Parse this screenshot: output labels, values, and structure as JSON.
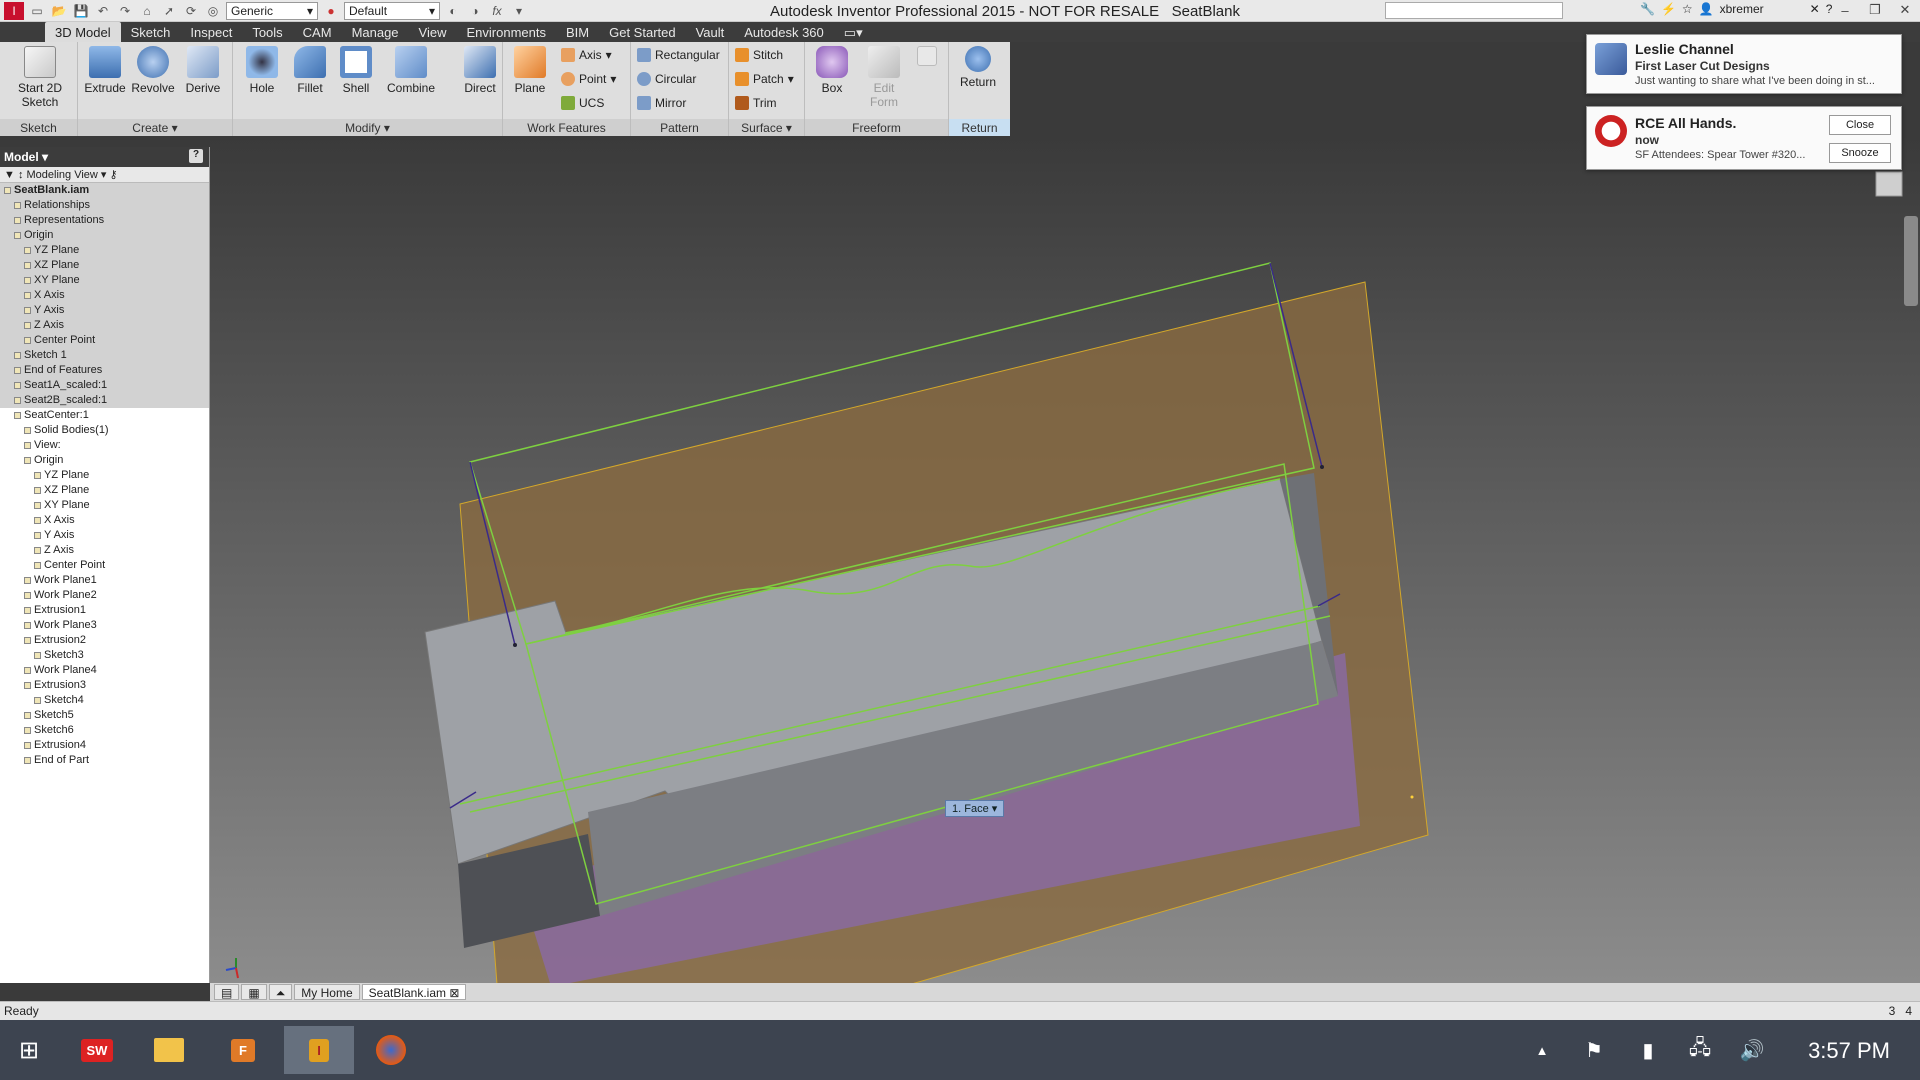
{
  "window": {
    "app_title": "Autodesk Inventor Professional 2015 - NOT FOR RESALE",
    "document": "SeatBlank",
    "material": "Generic",
    "appearance": "Default",
    "user": "xbremer"
  },
  "tabs": [
    "3D Model",
    "Sketch",
    "Inspect",
    "Tools",
    "CAM",
    "Manage",
    "View",
    "Environments",
    "BIM",
    "Get Started",
    "Vault",
    "Autodesk 360"
  ],
  "ribbon": {
    "panels": {
      "sketch": "Sketch",
      "create": "Create",
      "modify": "Modify",
      "work_features": "Work Features",
      "pattern": "Pattern",
      "surface": "Surface",
      "freeform": "Freeform",
      "return": "Return"
    },
    "buttons": {
      "start_sketch": "Start 2D Sketch",
      "extrude": "Extrude",
      "revolve": "Revolve",
      "derive": "Derive",
      "hole": "Hole",
      "fillet": "Fillet",
      "shell": "Shell",
      "combine": "Combine",
      "direct": "Direct",
      "plane": "Plane",
      "axis": "Axis",
      "point": "Point",
      "ucs": "UCS",
      "rectangular": "Rectangular",
      "circular": "Circular",
      "mirror": "Mirror",
      "stitch": "Stitch",
      "patch": "Patch",
      "trim": "Trim",
      "box": "Box",
      "edit_form": "Edit Form",
      "return": "Return"
    }
  },
  "browser": {
    "title": "Model",
    "view": "Modeling View",
    "items": [
      {
        "label": "SeatBlank.iam",
        "bold": true,
        "indent": 0,
        "grey": true
      },
      {
        "label": "Relationships",
        "indent": 1,
        "grey": true
      },
      {
        "label": "Representations",
        "indent": 1,
        "grey": true
      },
      {
        "label": "Origin",
        "indent": 1,
        "grey": true
      },
      {
        "label": "YZ Plane",
        "indent": 2,
        "grey": true
      },
      {
        "label": "XZ Plane",
        "indent": 2,
        "grey": true
      },
      {
        "label": "XY Plane",
        "indent": 2,
        "grey": true
      },
      {
        "label": "X Axis",
        "indent": 2,
        "grey": true
      },
      {
        "label": "Y Axis",
        "indent": 2,
        "grey": true
      },
      {
        "label": "Z Axis",
        "indent": 2,
        "grey": true
      },
      {
        "label": "Center Point",
        "indent": 2,
        "grey": true
      },
      {
        "label": "Sketch 1",
        "indent": 1,
        "grey": true
      },
      {
        "label": "End of Features",
        "indent": 1,
        "grey": true
      },
      {
        "label": "Seat1A_scaled:1",
        "indent": 1,
        "grey": true
      },
      {
        "label": "Seat2B_scaled:1",
        "indent": 1,
        "grey": true
      },
      {
        "label": "SeatCenter:1",
        "indent": 1
      },
      {
        "label": "Solid Bodies(1)",
        "indent": 2
      },
      {
        "label": "View:",
        "indent": 2
      },
      {
        "label": "Origin",
        "indent": 2
      },
      {
        "label": "YZ Plane",
        "indent": 3
      },
      {
        "label": "XZ Plane",
        "indent": 3
      },
      {
        "label": "XY Plane",
        "indent": 3
      },
      {
        "label": "X Axis",
        "indent": 3
      },
      {
        "label": "Y Axis",
        "indent": 3
      },
      {
        "label": "Z Axis",
        "indent": 3
      },
      {
        "label": "Center Point",
        "indent": 3
      },
      {
        "label": "Work Plane1",
        "indent": 2
      },
      {
        "label": "Work Plane2",
        "indent": 2
      },
      {
        "label": "Extrusion1",
        "indent": 2
      },
      {
        "label": "Work Plane3",
        "indent": 2
      },
      {
        "label": "Extrusion2",
        "indent": 2
      },
      {
        "label": "Sketch3",
        "indent": 3
      },
      {
        "label": "Work Plane4",
        "indent": 2
      },
      {
        "label": "Extrusion3",
        "indent": 2
      },
      {
        "label": "Sketch4",
        "indent": 3
      },
      {
        "label": "Sketch5",
        "indent": 2
      },
      {
        "label": "Sketch6",
        "indent": 2
      },
      {
        "label": "Extrusion4",
        "indent": 2
      },
      {
        "label": "End of Part",
        "indent": 2
      }
    ]
  },
  "viewport": {
    "selection_label": "1. Face"
  },
  "doc_tabs": [
    "My Home",
    "SeatBlank.iam"
  ],
  "status": {
    "text": "Ready",
    "left_num": "3",
    "right_num": "4"
  },
  "notifications": [
    {
      "title": "Leslie Channel",
      "subtitle": "First Laser Cut Designs",
      "body": "Just wanting to share what I've been doing in st..."
    },
    {
      "title": "RCE All Hands.",
      "subtitle": "now",
      "body": "SF Attendees: Spear Tower  #320...",
      "close": "Close",
      "snooze": "Snooze"
    }
  ],
  "taskbar": {
    "clock": "3:57 PM"
  }
}
